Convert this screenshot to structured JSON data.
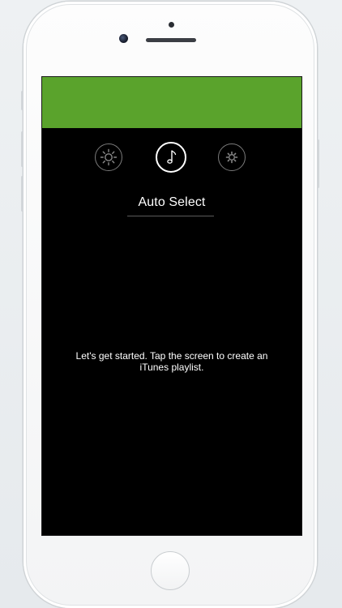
{
  "modes": [
    {
      "id": "brightness",
      "icon": "sun-icon",
      "active": false
    },
    {
      "id": "music",
      "icon": "music-note-icon",
      "active": true
    },
    {
      "id": "settings",
      "icon": "gear-icon",
      "active": false
    }
  ],
  "selector": {
    "label": "Auto Select"
  },
  "main": {
    "instruction": "Let's get started. Tap the screen to create an iTunes playlist."
  },
  "colors": {
    "header": "#5aa32c",
    "background": "#000000",
    "text": "#ffffff"
  }
}
